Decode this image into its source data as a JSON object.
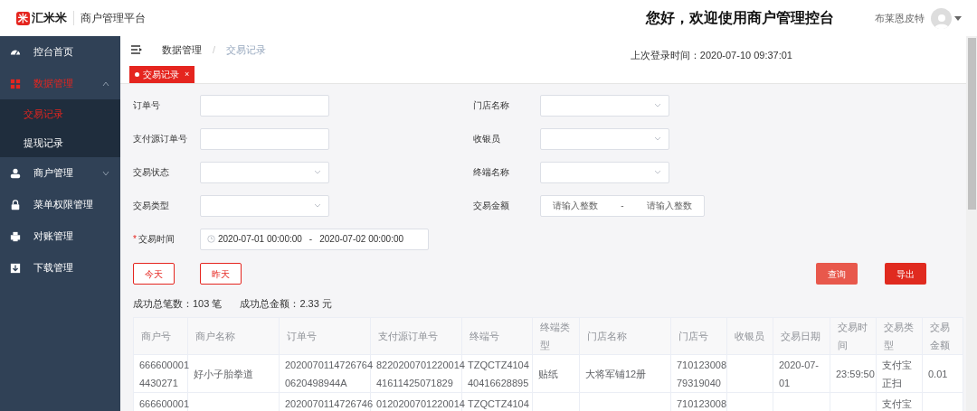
{
  "header": {
    "logo_mark": "米",
    "logo_text": "汇米米",
    "platform": "商户管理平台",
    "welcome": "您好，欢迎使用商户管理控台",
    "user": "布莱恩皮特",
    "last_login": "上次登录时间：2020-07-10 09:37:01"
  },
  "sidebar": {
    "items": [
      {
        "label": "控台首页",
        "selected": false
      },
      {
        "label": "数据管理",
        "selected": true,
        "expanded": true,
        "children": [
          {
            "label": "交易记录",
            "selected": true
          },
          {
            "label": "提现记录",
            "selected": false
          }
        ]
      },
      {
        "label": "商户管理",
        "selected": false,
        "expanded": false
      },
      {
        "label": "菜单权限管理",
        "selected": false
      },
      {
        "label": "对账管理",
        "selected": false
      },
      {
        "label": "下载管理",
        "selected": false
      }
    ]
  },
  "breadcrumb": {
    "items": [
      "数据管理",
      "交易记录"
    ],
    "separator": "/"
  },
  "tabs": [
    {
      "label": "交易记录",
      "close": "×",
      "selected": true
    }
  ],
  "form": {
    "left": [
      {
        "kind": "text",
        "label": "订单号"
      },
      {
        "kind": "text",
        "label": "支付源订单号"
      },
      {
        "kind": "select",
        "label": "交易状态"
      },
      {
        "kind": "select",
        "label": "交易类型"
      },
      {
        "kind": "daterange",
        "label": "交易时间",
        "required_mark": "*",
        "start": "2020-07-01 00:00:00",
        "separator": "-",
        "end": "2020-07-02 00:00:00"
      }
    ],
    "right": [
      {
        "kind": "select",
        "label": "门店名称"
      },
      {
        "kind": "select",
        "label": "收银员"
      },
      {
        "kind": "select",
        "label": "终端名称"
      },
      {
        "kind": "range",
        "label": "交易金额",
        "placeholder_min": "请输入整数",
        "separator": "-",
        "placeholder_max": "请输入整数"
      }
    ],
    "quick_buttons": [
      "今天",
      "昨天"
    ],
    "actions": [
      "查询",
      "导出"
    ]
  },
  "summary": [
    "成功总笔数：103 笔",
    "成功总金额：2.33 元"
  ],
  "table": {
    "columns": [
      "商户号",
      "商户名称",
      "订单号",
      "支付源订单号",
      "终端号",
      "终端类型",
      "门店名称",
      "门店号",
      "收银员",
      "交易日期",
      "交易时间",
      "交易类型",
      "交易金额"
    ],
    "rows": [
      [
        "666600001\n4430271",
        "好小子胎拳道",
        "2020070114726764\n0620498944A",
        "8220200701220014\n41611425071829",
        "TZQCTZ4104\n40416628895",
        "贴纸",
        "大将军铺12册",
        "710123008\n79319040",
        "",
        "2020-07-01",
        "23:59:50",
        "支付宝正扫",
        "0.01"
      ],
      [
        "666600001",
        "",
        "2020070114726746",
        "0120200701220014",
        "TZQCTZ4104",
        "",
        "",
        "710123008",
        "",
        "",
        "",
        "支付宝",
        ""
      ]
    ]
  }
}
